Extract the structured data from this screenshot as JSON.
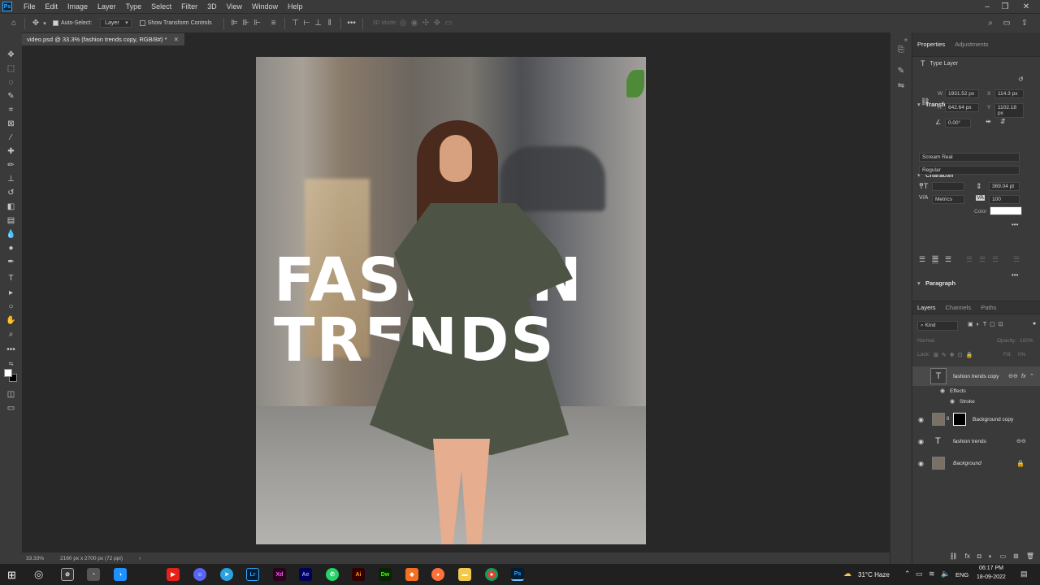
{
  "menubar": {
    "logo": "Ps",
    "items": [
      "File",
      "Edit",
      "Image",
      "Layer",
      "Type",
      "Select",
      "Filter",
      "3D",
      "View",
      "Window",
      "Help"
    ]
  },
  "options": {
    "auto_select_label": "Auto-Select:",
    "auto_select_value": "Layer",
    "show_transform_label": "Show Transform Controls",
    "mode_3d_label": "3D Mode:"
  },
  "document": {
    "tab_title": "video.psd @ 33.3% (fashion trends copy, RGB/8#) *",
    "headline_line1": "FASHION",
    "headline_line2": "TRENDS"
  },
  "status": {
    "zoom": "33.33%",
    "doc_info": "2160 px x 2700 px (72 ppi)"
  },
  "properties": {
    "tabs": [
      "Properties",
      "Adjustments"
    ],
    "layer_type": "Type Layer",
    "transform": {
      "title": "Transform",
      "w_label": "W",
      "w_value": "1931.52 px",
      "h_label": "H",
      "h_value": "642.64 px",
      "x_label": "X",
      "x_value": "114.3 px",
      "y_label": "Y",
      "y_value": "1102.18 px",
      "angle": "0.00°"
    },
    "character": {
      "title": "Character",
      "font": "Scream Real",
      "style": "Regular",
      "leading": "369.04 pt",
      "kerning": "Metrics",
      "tracking": "100",
      "color_label": "Color",
      "color_value": "#ffffff"
    },
    "paragraph": {
      "title": "Paragraph"
    }
  },
  "layers_panel": {
    "tabs": [
      "Layers",
      "Channels",
      "Paths"
    ],
    "filter_kind": "Kind",
    "blend_mode": "Normal",
    "opacity_label": "Opacity:",
    "opacity_value": "100%",
    "lock_label": "Lock:",
    "fill_label": "Fill:",
    "fill_value": "0%",
    "layers": [
      {
        "name": "fashion trends copy",
        "type": "text",
        "visible": false,
        "fx": true
      },
      {
        "name": "Effects",
        "type": "effects-header"
      },
      {
        "name": "Stroke",
        "type": "effect"
      },
      {
        "name": "Background copy",
        "type": "image-mask",
        "visible": true
      },
      {
        "name": "fashion trends",
        "type": "text",
        "visible": true
      },
      {
        "name": "Background",
        "type": "image",
        "visible": true,
        "locked": true
      }
    ]
  },
  "taskbar": {
    "weather": "31°C  Haze",
    "language": "ENG",
    "time": "06:17 PM",
    "date": "18-09-2022",
    "apps": [
      "Lr",
      "Xd",
      "Ae",
      "Ai",
      "Dw",
      "Ps"
    ]
  }
}
